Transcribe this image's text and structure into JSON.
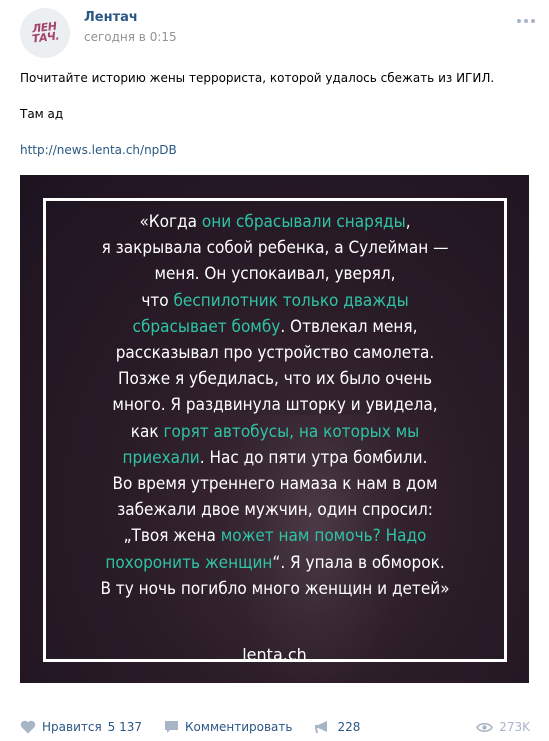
{
  "post": {
    "author": "Лентач",
    "logo_top": "ЛЕН",
    "logo_bottom": "ТАЧ.",
    "time": "сегодня в 0:15",
    "text": {
      "line1": "Почитайте историю жены террориста, которой удалось сбежать из ИГИЛ.",
      "line2": "Там ад",
      "link": "http://news.lenta.ch/npDB"
    },
    "image": {
      "quote": {
        "l1a": "«Когда ",
        "l1b": "они сбрасывали снаряды",
        "l1c": ",",
        "l2": "я закрывала собой ребенка, а Сулейман —",
        "l3": "меня. Он успокаивал, уверял,",
        "l4a": "что ",
        "l4b": "беспилотник только дважды",
        "l5a": "сбрасывает бомбу",
        "l5b": ". Отвлекал меня,",
        "l6": "рассказывал про устройство самолета.",
        "l7": "Позже я убедилась, что их было очень",
        "l8": "много. Я раздвинула шторку и увидела,",
        "l9a": "как ",
        "l9b": "горят автобусы, на которых мы",
        "l10a": "приехали",
        "l10b": ". Нас до пяти утра бомбили.",
        "l11": "Во время утреннего намаза к нам в дом",
        "l12": "забежали двое мужчин, один спросил:",
        "l13a": "„Твоя жена ",
        "l13b": "может нам помочь? Надо",
        "l14a": "похоронить женщин",
        "l14b": "“. Я упала в обморок.",
        "l15": "В ту ночь погибло много женщин и детей»"
      },
      "watermark": "lenta.ch"
    },
    "footer": {
      "like_label": "Нравится",
      "like_count": "5 137",
      "comment_label": "Комментировать",
      "share_count": "228",
      "views": "273K"
    }
  },
  "colors": {
    "link": "#2a5885",
    "highlight": "#2fc3a3",
    "logo": "#a5436f",
    "muted": "#939393",
    "icon": "#a8b5c7"
  }
}
